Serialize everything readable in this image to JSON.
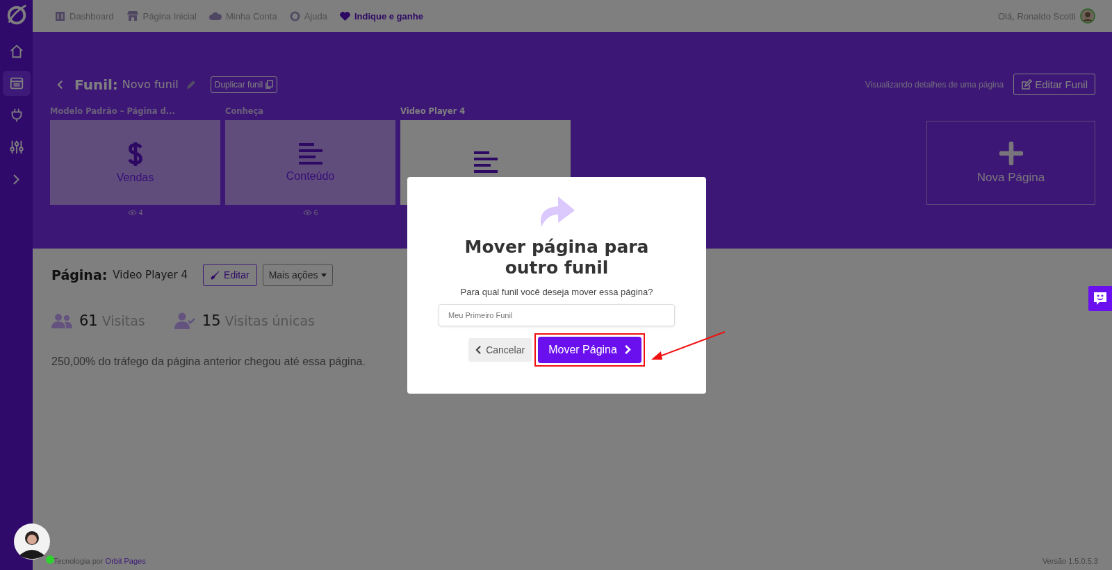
{
  "top_nav": {
    "items": [
      {
        "kind": "dashboard",
        "label": "Dashboard",
        "highlighted": false
      },
      {
        "kind": "store",
        "label": "Página Inicial",
        "highlighted": false
      },
      {
        "kind": "cloud",
        "label": "Minha Conta",
        "highlighted": false
      },
      {
        "kind": "help",
        "label": "Ajuda",
        "highlighted": false
      },
      {
        "kind": "heart",
        "label": "Indique e ganhe",
        "highlighted": true
      }
    ],
    "greeting": "Olá, Ronaldo Scotti"
  },
  "sidebar": {
    "items": [
      {
        "kind": "home",
        "selected": false
      },
      {
        "kind": "pages",
        "selected": true
      },
      {
        "kind": "plug",
        "selected": false
      },
      {
        "kind": "sliders",
        "selected": false
      },
      {
        "kind": "expand",
        "selected": false
      }
    ]
  },
  "funnel": {
    "label": "Funil:",
    "name": "Novo funil",
    "duplicate_button": "Duplicar funil",
    "status": "Visualizando detalhes de uma página",
    "edit_button": "Editar Funil",
    "pages": [
      {
        "title": "Modelo Padrão – Página d...",
        "kind": "sales",
        "type": "Vendas",
        "views": "4",
        "selected": false
      },
      {
        "title": "Conheça",
        "kind": "content",
        "type": "Conteúdo",
        "views": "6",
        "selected": false
      },
      {
        "title": "Video Player 4",
        "kind": "content",
        "selected": true
      }
    ],
    "new_page": "Nova Página"
  },
  "page_detail": {
    "label": "Página:",
    "name": "Video Player 4",
    "edit_button": "Editar",
    "more_button": "Mais ações",
    "stats": [
      {
        "kind": "visits",
        "value": "61",
        "label": "Visitas"
      },
      {
        "kind": "unique",
        "value": "15",
        "label": "Visitas únicas"
      }
    ],
    "traffic_note": "250,00% do tráfego da página anterior chegou até essa página."
  },
  "footer": {
    "credit": "Tecnologia por",
    "link": "Orbit Pages",
    "version": "Versão 1.5.0.5.3"
  },
  "modal": {
    "title": "Mover página para outro funil",
    "question": "Para qual funil você deseja mover essa página?",
    "select_value": "Meu Primeiro Funil",
    "cancel": "Cancelar",
    "confirm": "Mover Página"
  }
}
